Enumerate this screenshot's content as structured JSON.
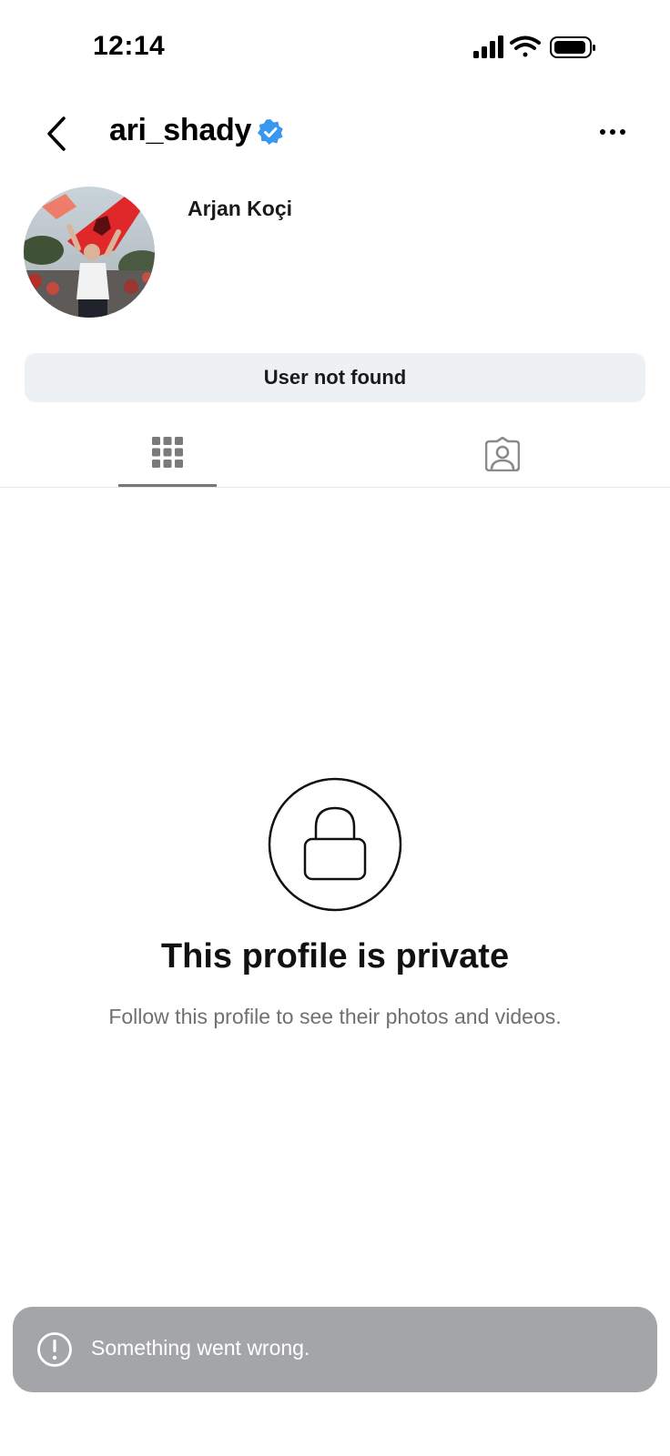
{
  "status_bar": {
    "time": "12:14"
  },
  "header": {
    "back_icon": "chevron-left-icon",
    "username": "ari_shady",
    "verified_icon": "verified-badge-icon",
    "more_icon": "more-horizontal-icon"
  },
  "profile": {
    "full_name": "Arjan Koçi",
    "action_button_label": "User not found"
  },
  "tabs": [
    {
      "name": "posts",
      "icon": "grid-icon",
      "selected": true
    },
    {
      "name": "tagged",
      "icon": "tagged-person-icon",
      "selected": false
    }
  ],
  "private_notice": {
    "icon": "lock-icon",
    "title": "This profile is private",
    "subtitle": "Follow this profile to see their photos and videos."
  },
  "toast": {
    "icon": "alert-circle-icon",
    "message": "Something went wrong."
  },
  "colors": {
    "verified_blue": "#3897f0",
    "button_bg": "#eef1f4",
    "toast_bg": "#a3a5a8",
    "muted_text": "#707070"
  }
}
